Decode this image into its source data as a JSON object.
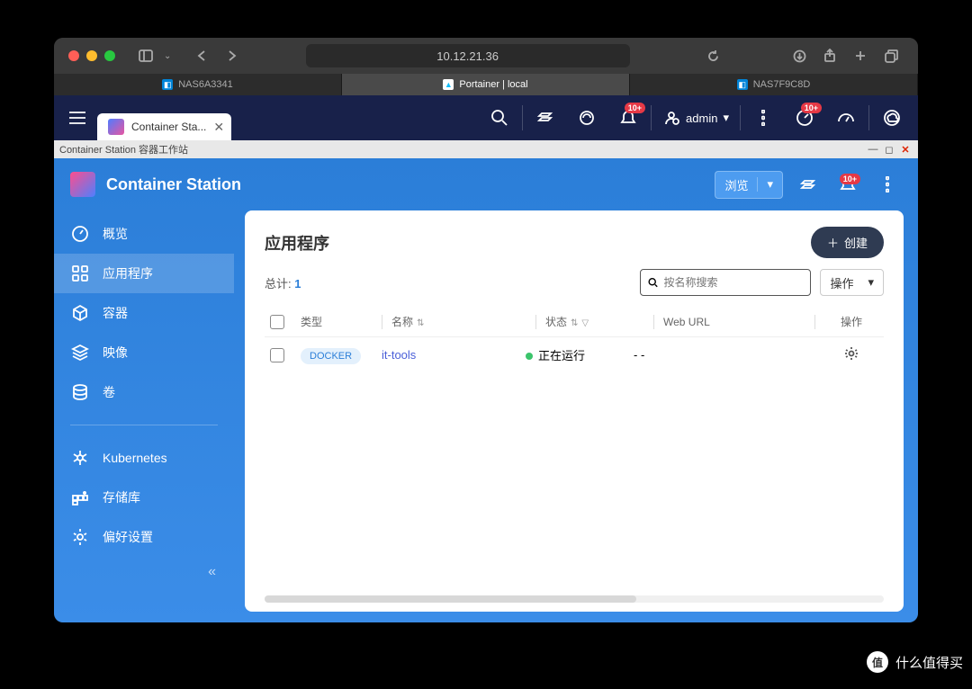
{
  "browser": {
    "url": "10.12.21.36",
    "tabs": [
      {
        "label": "NAS6A3341"
      },
      {
        "label": "Portainer | local"
      },
      {
        "label": "NAS7F9C8D"
      }
    ]
  },
  "app_header": {
    "tab_label": "Container Sta...",
    "admin_label": "admin",
    "badge_notifications": "10+",
    "badge_dashboard": "10+"
  },
  "window": {
    "title": "Container Station 容器工作站"
  },
  "cs": {
    "title": "Container Station",
    "browse_label": "浏览",
    "bell_badge": "10+",
    "sidebar": [
      {
        "label": "概览"
      },
      {
        "label": "应用程序"
      },
      {
        "label": "容器"
      },
      {
        "label": "映像"
      },
      {
        "label": "卷"
      },
      {
        "label": "Kubernetes"
      },
      {
        "label": "存储库"
      },
      {
        "label": "偏好设置"
      }
    ]
  },
  "panel": {
    "title": "应用程序",
    "create_label": "创建",
    "total_label": "总计:",
    "total_count": "1",
    "search_placeholder": "按名称搜索",
    "action_label": "操作",
    "columns": {
      "type": "类型",
      "name": "名称",
      "status": "状态",
      "url": "Web URL",
      "action": "操作"
    },
    "rows": [
      {
        "type_badge": "DOCKER",
        "name": "it-tools",
        "status": "正在运行",
        "url": "- -"
      }
    ]
  },
  "watermark": {
    "circle": "值",
    "text": "什么值得买"
  }
}
